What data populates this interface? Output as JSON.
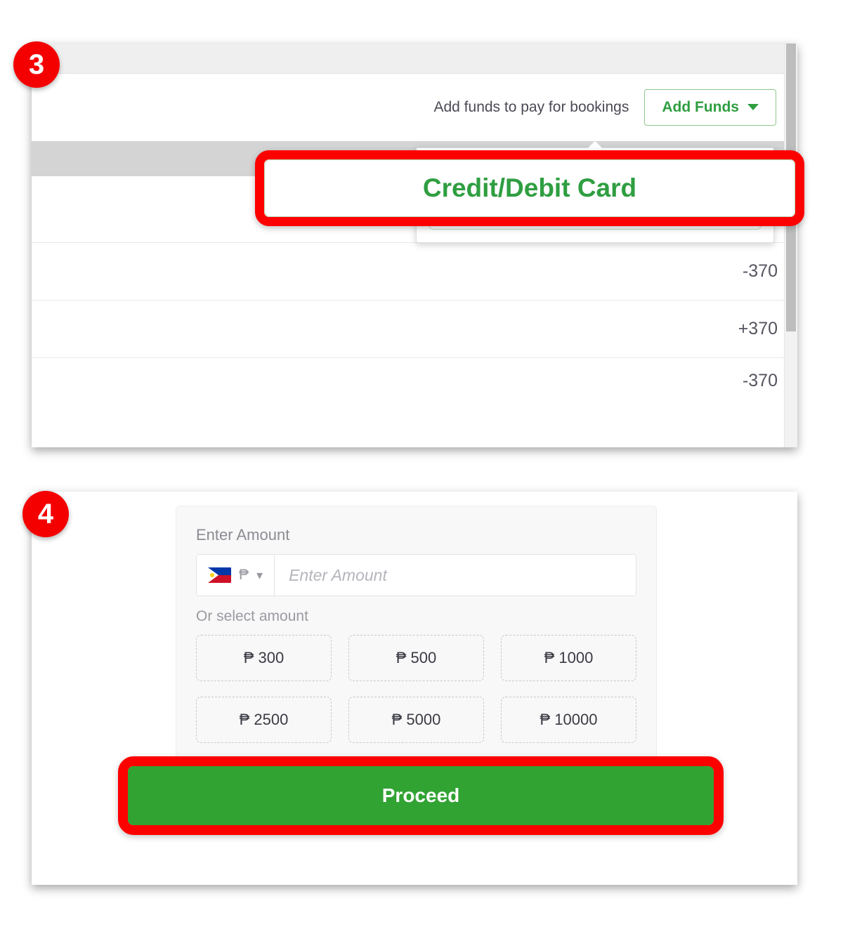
{
  "steps": {
    "three": "3",
    "four": "4"
  },
  "panel3": {
    "wallet": {
      "add_funds_hint": "Add funds to pay for bookings",
      "add_funds_button": "Add Funds",
      "caret_icon": "chevron-down-icon"
    },
    "dropdown": {
      "options": [
        {
          "label": "Credit/Debit Card"
        }
      ]
    },
    "callout": {
      "label": "Credit/Debit Card"
    },
    "transactions": [
      {
        "amount": ""
      },
      {
        "amount": "-370"
      },
      {
        "amount": "+370"
      },
      {
        "amount": "-370"
      }
    ]
  },
  "panel4": {
    "form": {
      "amount_label": "Enter Amount",
      "amount_placeholder": "Enter Amount",
      "amount_value": "",
      "currency_symbol": "₱",
      "currency_flag_icon": "philippines-flag-icon",
      "currency_caret_icon": "chevron-down-icon",
      "or_select_label": "Or select amount",
      "presets": [
        "₱ 300",
        "₱ 500",
        "₱ 1000",
        "₱ 2500",
        "₱ 5000",
        "₱ 10000"
      ]
    },
    "proceed_button": "Proceed"
  },
  "colors": {
    "brand_green": "#2f9e41",
    "proceed_green": "#31a333",
    "highlight_red": "#fd0000",
    "badge_red": "#f50000"
  }
}
